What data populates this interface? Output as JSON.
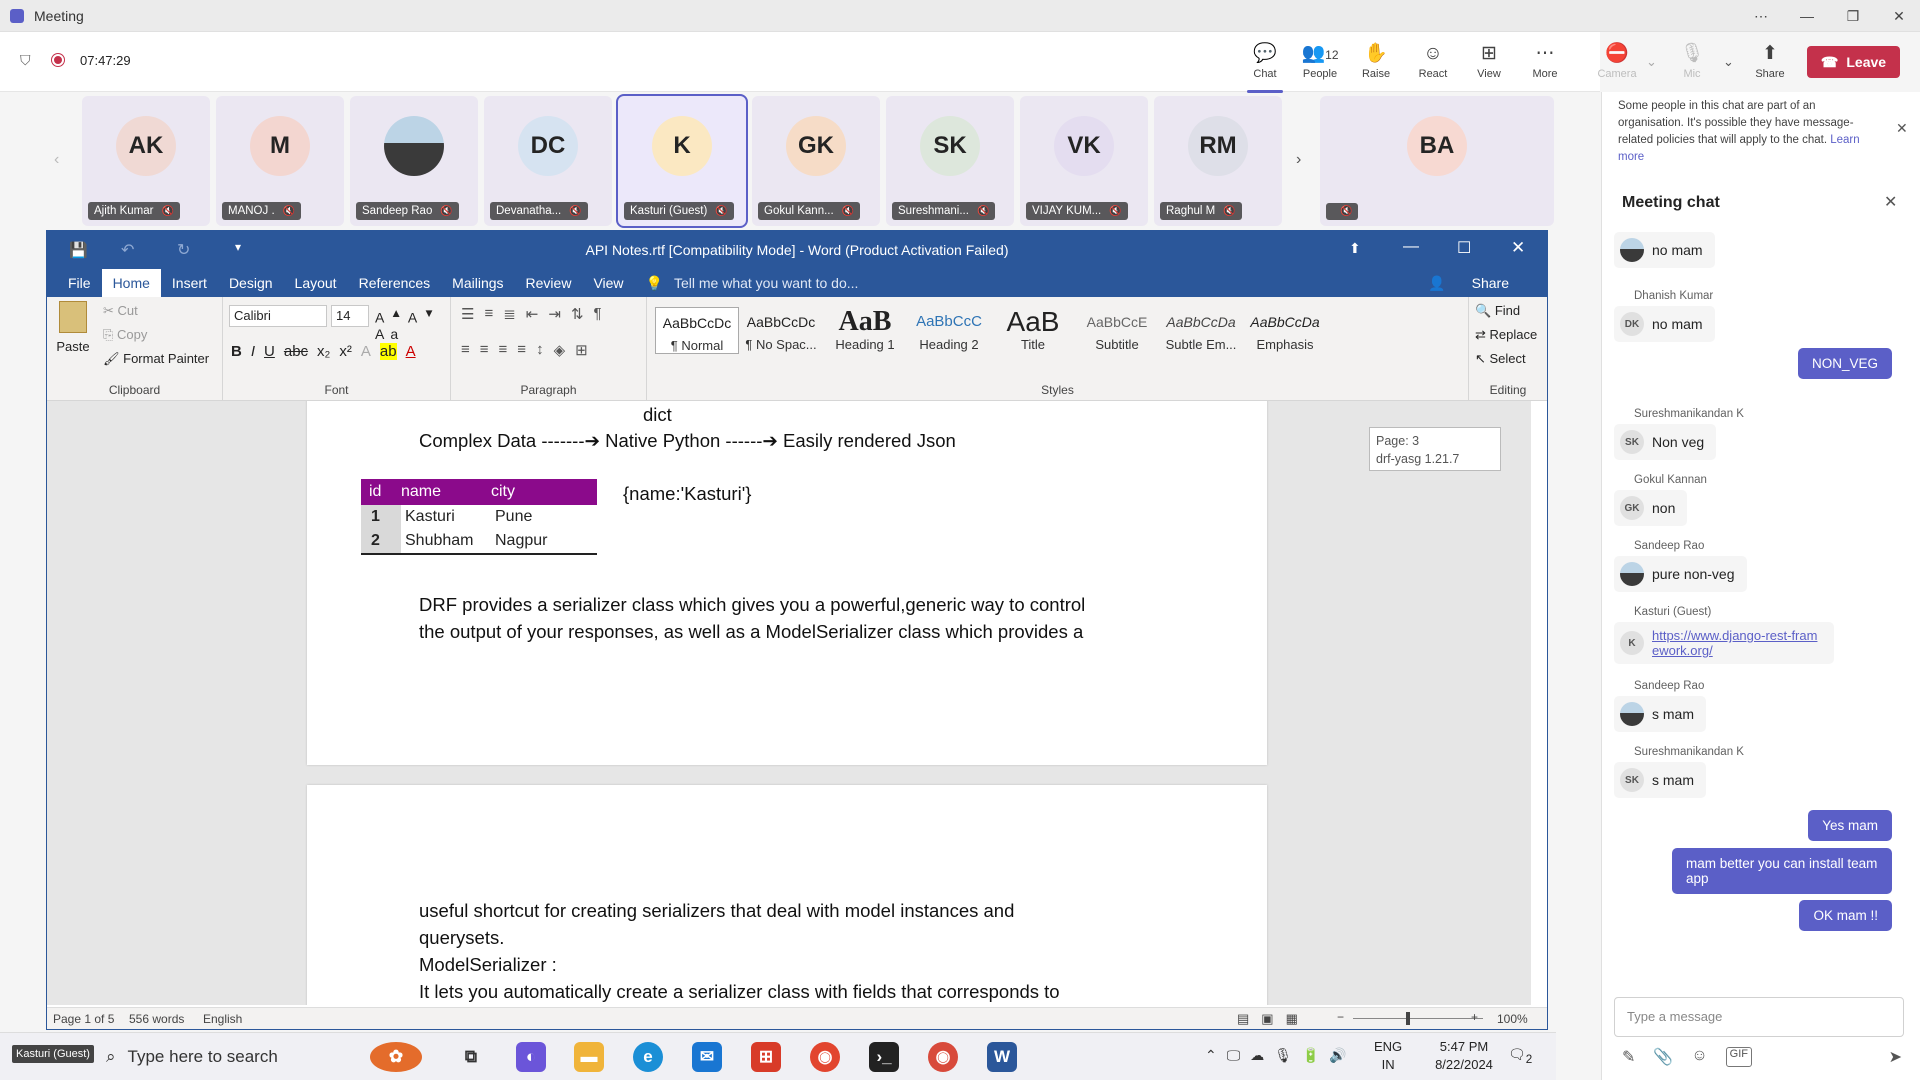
{
  "teams": {
    "title": "Meeting",
    "timer": "07:47:29",
    "buttons": {
      "chat": "Chat",
      "people": "People",
      "people_count": "12",
      "raise": "Raise",
      "react": "React",
      "view": "View",
      "more": "More",
      "camera": "Camera",
      "mic": "Mic",
      "share": "Share",
      "leave": "Leave"
    }
  },
  "participants": [
    {
      "initials": "AK",
      "name": "Ajith Kumar",
      "color": "#f0d9d4"
    },
    {
      "initials": "M",
      "name": "MANOJ .",
      "color": "#f3d6d0"
    },
    {
      "initials": "",
      "name": "Sandeep Rao",
      "color": "#d9d9d9"
    },
    {
      "initials": "DC",
      "name": "Devanatha...",
      "color": "#d6e3f1"
    },
    {
      "initials": "K",
      "name": "Kasturi (Guest)",
      "color": "#fbe8c2"
    },
    {
      "initials": "GK",
      "name": "Gokul Kann...",
      "color": "#f6dcc7"
    },
    {
      "initials": "SK",
      "name": "Sureshmani...",
      "color": "#dde7dc"
    },
    {
      "initials": "VK",
      "name": "VIJAY KUM...",
      "color": "#e4ddf0"
    },
    {
      "initials": "RM",
      "name": "Raghul M",
      "color": "#dedfe8"
    },
    {
      "initials": "BA",
      "name": "",
      "color": "#f7d9d2"
    }
  ],
  "chat": {
    "notice": "Some people in this chat are part of an organisation. It's possible they have message-related policies that will apply to the chat.",
    "notice_link": "Learn more",
    "header": "Meeting chat",
    "messages": [
      {
        "sender": "",
        "initials": "",
        "text": "no mam"
      },
      {
        "sender": "Dhanish Kumar",
        "initials": "DK",
        "text": "no mam"
      },
      {
        "mine": true,
        "text": "NON_VEG"
      },
      {
        "sender": "Sureshmanikandan K",
        "initials": "SK",
        "text": "Non veg"
      },
      {
        "sender": "Gokul Kannan",
        "initials": "GK",
        "text": "non"
      },
      {
        "sender": "Sandeep Rao",
        "initials": "",
        "text": "pure non-veg"
      },
      {
        "sender": "Kasturi (Guest)",
        "initials": "K",
        "text": "https://www.django-rest-framework.org/"
      },
      {
        "sender": "Sandeep Rao",
        "initials": "",
        "text": "s mam"
      },
      {
        "sender": "Sureshmanikandan K",
        "initials": "SK",
        "text": "s mam"
      },
      {
        "mine": true,
        "text": "Yes mam"
      },
      {
        "mine": true,
        "text": "mam better you can install team app"
      },
      {
        "mine": true,
        "text": "OK mam !!"
      }
    ],
    "input_placeholder": "Type a message"
  },
  "word": {
    "title": "API Notes.rtf [Compatibility Mode] - Word (Product Activation Failed)",
    "tabs": [
      "File",
      "Home",
      "Insert",
      "Design",
      "Layout",
      "References",
      "Mailings",
      "Review",
      "View"
    ],
    "tell_me": "Tell me what you want to do...",
    "share": "Share",
    "clipboard": {
      "paste": "Paste",
      "cut": "Cut",
      "copy": "Copy",
      "format_painter": "Format Painter",
      "label": "Clipboard"
    },
    "font": {
      "name": "Calibri",
      "size": "14",
      "label": "Font"
    },
    "paragraph_label": "Paragraph",
    "styles": [
      {
        "preview": "AaBbCcDc",
        "label": "¶ Normal"
      },
      {
        "preview": "AaBbCcDc",
        "label": "¶ No Spac..."
      },
      {
        "preview": "AaB",
        "label": "Heading 1"
      },
      {
        "preview": "AaBbCcC",
        "label": "Heading 2"
      },
      {
        "preview": "AaB",
        "label": "Title"
      },
      {
        "preview": "AaBbCcE",
        "label": "Subtitle"
      },
      {
        "preview": "AaBbCcDa",
        "label": "Subtle Em..."
      },
      {
        "preview": "AaBbCcDa",
        "label": "Emphasis"
      }
    ],
    "styles_label": "Styles",
    "editing": {
      "find": "Find",
      "replace": "Replace",
      "select": "Select",
      "label": "Editing"
    },
    "doc": {
      "dict": "dict",
      "flow": "Complex Data -------➔ Native Python ------➔ Easily rendered Json",
      "table_headers": [
        "id",
        "name",
        "city"
      ],
      "table_rows": [
        [
          "1",
          "Kasturi",
          "Pune"
        ],
        [
          "2",
          "Shubham",
          "Nagpur"
        ]
      ],
      "json_example": "{name:'Kasturi'}",
      "para1_line1": "DRF provides a serializer class which gives you a powerful,generic way to control",
      "para1_line2": "the output of your responses, as well as a ModelSerializer class which provides a",
      "para2_line1": "useful shortcut for creating serializers that deal with model instances and",
      "para2_line2": "querysets.",
      "para2_line3": "ModelSerializer :",
      "para2_line4": "It lets you automatically create a serializer class with fields that corresponds to",
      "tooltip_page": "Page: 3",
      "tooltip_section": "drf-yasg 1.21.7"
    },
    "status": {
      "page": "Page 1 of 5",
      "words": "556 words",
      "lang": "English",
      "zoom": "100%"
    }
  },
  "taskbar": {
    "user_label": "Kasturi (Guest)",
    "search_placeholder": "Type here to search",
    "lang": "ENG",
    "region": "IN",
    "time": "5:47 PM",
    "date": "8/22/2024",
    "notif_count": "2"
  }
}
